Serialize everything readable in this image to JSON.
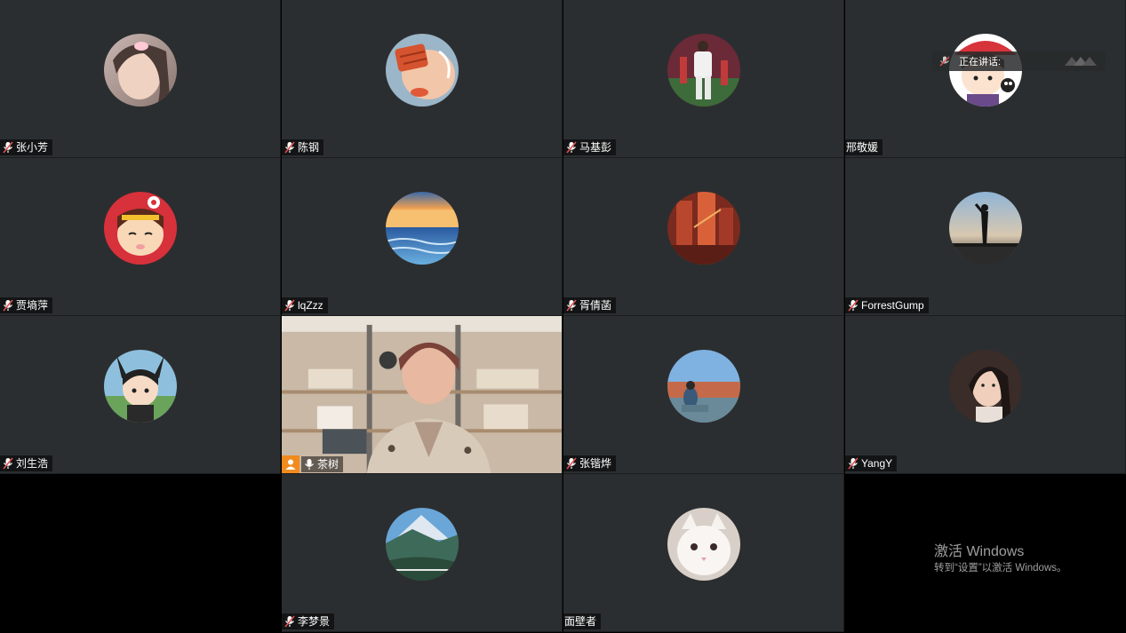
{
  "participants": [
    {
      "name": "张小芳",
      "muted": true,
      "avatar": "woman-selfie-avatar"
    },
    {
      "name": "陈钢",
      "muted": true,
      "avatar": "cartoon-character-avatar"
    },
    {
      "name": "马基彭",
      "muted": true,
      "avatar": "soccer-player-avatar"
    },
    {
      "name": "邢敬媛",
      "muted": false,
      "avatar": "cartoon-girl-red-hat-avatar"
    },
    {
      "name": "贾墒萍",
      "muted": true,
      "avatar": "cartoon-girl-red-avatar"
    },
    {
      "name": "lqZzz",
      "muted": true,
      "avatar": "ocean-sunset-avatar"
    },
    {
      "name": "胥倩菡",
      "muted": true,
      "avatar": "red-building-avatar"
    },
    {
      "name": "ForrestGump",
      "muted": true,
      "avatar": "silhouette-sunset-avatar"
    },
    {
      "name": "刘生浩",
      "muted": true,
      "avatar": "anime-character-avatar"
    },
    {
      "name": "茶树",
      "muted": false,
      "video": true,
      "host": true
    },
    {
      "name": "张锴烨",
      "muted": true,
      "avatar": "person-seaside-avatar"
    },
    {
      "name": "YangY",
      "muted": true,
      "avatar": "woman-portrait-avatar"
    },
    {
      "name": "李梦景",
      "muted": true,
      "avatar": "mountain-landscape-avatar"
    },
    {
      "name": "面壁者",
      "muted": false,
      "avatar": "white-cat-avatar"
    }
  ],
  "speaking_indicator": {
    "label": "正在讲话:"
  },
  "watermark": {
    "title": "激活 Windows",
    "subtitle": "转到“设置”以激活 Windows。"
  },
  "colors": {
    "tile_bg": "#2b2e30",
    "host_badge": "#f28b1e",
    "muted_mic": "#e05050"
  }
}
